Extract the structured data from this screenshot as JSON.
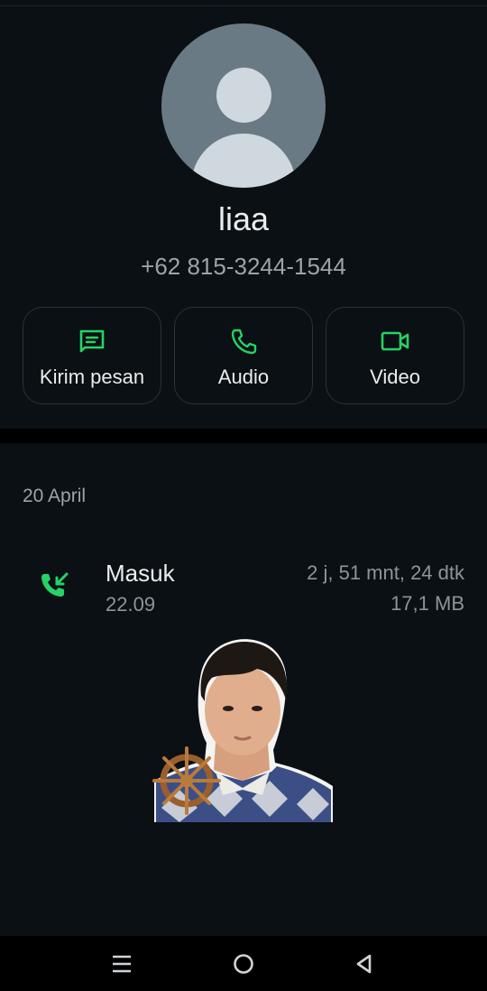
{
  "contact": {
    "name": "liaa",
    "phone": "+62 815-3244-1544"
  },
  "actions": [
    {
      "label": "Kirim pesan",
      "icon": "message-icon"
    },
    {
      "label": "Audio",
      "icon": "phone-icon"
    },
    {
      "label": "Video",
      "icon": "video-icon"
    }
  ],
  "call_log": {
    "date": "20 April",
    "entries": [
      {
        "type": "Masuk",
        "time": "22.09",
        "duration": "2 j, 51 mnt, 24 dtk",
        "size": "17,1 MB",
        "icon": "incoming-call-icon"
      }
    ]
  },
  "colors": {
    "background": "#0b1014",
    "accent": "#25d366",
    "text_primary": "#e9edef",
    "text_secondary": "#8b959b"
  },
  "navbar": {
    "buttons": [
      "menu-icon",
      "home-icon",
      "back-icon"
    ]
  }
}
